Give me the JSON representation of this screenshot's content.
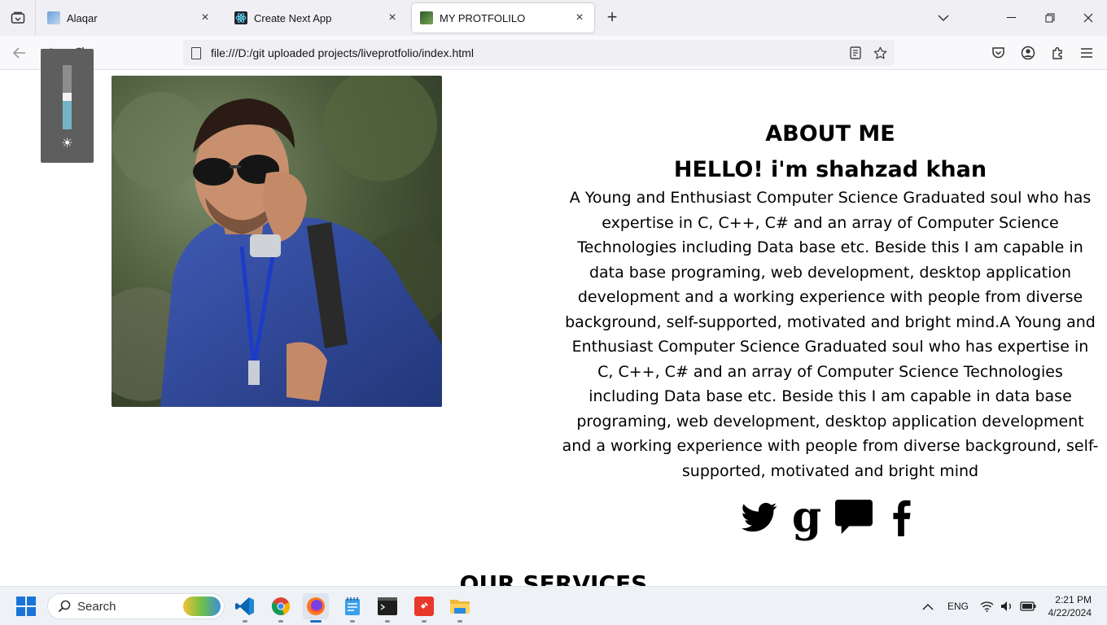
{
  "browser": {
    "tabs": [
      {
        "title": "Alaqar",
        "active": false
      },
      {
        "title": "Create Next App",
        "active": false
      },
      {
        "title": "MY PROTFOLILO",
        "active": true
      }
    ],
    "url": "file:///D:/git uploaded projects/liveprotfolio/index.html"
  },
  "brightness": {
    "level": 0.5
  },
  "page": {
    "about_title": "ABOUT ME",
    "hello": "HELLO! i'm shahzad khan",
    "bio": "A Young and Enthusiast Computer Science Graduated soul who has expertise in C, C++, C# and an array of Computer Science Technologies including Data base etc. Beside this I am capable in data base programing, web development, desktop application development and a working experience with people from diverse background, self-supported, motivated and bright mind.A Young and Enthusiast Computer Science Graduated soul who has expertise in C, C++, C# and an array of Computer Science Technologies including Data base etc. Beside this I am capable in data base programing, web development, desktop application development and a working experience with people from diverse background, self-supported, motivated and bright mind",
    "social_icons": [
      "twitter-icon",
      "google-icon",
      "chat-icon",
      "facebook-icon"
    ],
    "services_title": "OUR SERVICES"
  },
  "taskbar": {
    "search_label": "Search",
    "language": "ENG",
    "time": "2:21 PM",
    "date": "4/22/2024"
  }
}
